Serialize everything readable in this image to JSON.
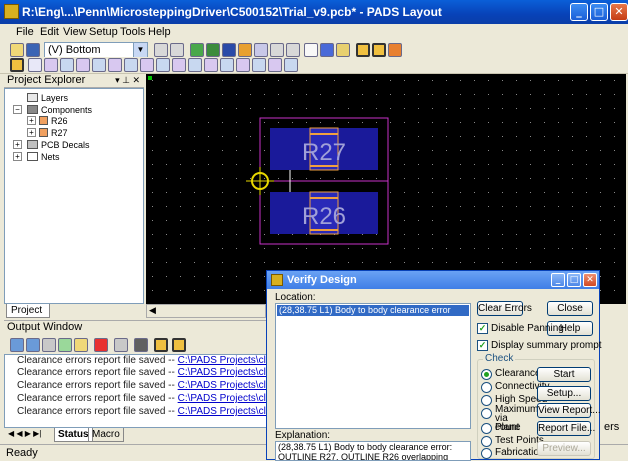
{
  "window": {
    "title": "R:\\Eng\\...\\Penn\\MicrosteppingDriver\\C500152\\Trial_v9.pcb* - PADS Layout",
    "min": "_",
    "max": "□",
    "close": "✕"
  },
  "menu": [
    "File",
    "Edit",
    "View",
    "Setup",
    "Tools",
    "Help"
  ],
  "toolbar": {
    "layer_select": "(V) Bottom"
  },
  "project_explorer": {
    "title": "Project Explorer",
    "items": [
      {
        "label": "Layers",
        "indent": 0,
        "expander": ""
      },
      {
        "label": "Components",
        "indent": 0,
        "expander": "−"
      },
      {
        "label": "R26",
        "indent": 1,
        "expander": "+"
      },
      {
        "label": "R27",
        "indent": 1,
        "expander": "+"
      },
      {
        "label": "PCB Decals",
        "indent": 0,
        "expander": "+"
      },
      {
        "label": "Nets",
        "indent": 0,
        "expander": "+"
      }
    ],
    "tab": "Project"
  },
  "canvas": {
    "colors": {
      "background": "#000000",
      "outline": "#c832c8",
      "pad": "#1a1a9a",
      "pad_edge": "#f0a040",
      "cursor": "#e8d800",
      "ref_text": "#a0a0d8"
    },
    "parts": [
      {
        "ref": "R27"
      },
      {
        "ref": "R26"
      }
    ]
  },
  "output_window": {
    "title": "Output Window",
    "lines": [
      {
        "text": "Clearance errors report file saved -- ",
        "link": "C:\\PADS Projects\\clear.lst"
      },
      {
        "text": "Clearance errors report file saved -- ",
        "link": "C:\\PADS Projects\\clear.lst"
      },
      {
        "text": "Clearance errors report file saved -- ",
        "link": "C:\\PADS Projects\\clear.lst"
      },
      {
        "text": "Clearance errors report file saved -- ",
        "link": "C:\\PADS Projects\\clear.lst"
      },
      {
        "text": "Clearance errors report file saved -- ",
        "link": "C:\\PADS Projects\\clear.lst"
      }
    ],
    "tabs": [
      "Status",
      "Macro"
    ]
  },
  "status": {
    "text": "Ready",
    "right": "ers"
  },
  "verify_dialog": {
    "title": "Verify Design",
    "location_label": "Location:",
    "selected_item": "(28,38.75 L1) Body to body clearance error",
    "explanation_label": "Explanation:",
    "explanation_lines": [
      "(28,38.75 L1) Body to body clearance error:",
      "OUTLINE R27, OUTLINE R26 overlapping"
    ],
    "buttons": {
      "clear_errors": "Clear Errors",
      "close": "Close",
      "help": "Help",
      "start": "Start",
      "setup": "Setup...",
      "view_report": "View Report...",
      "report_file": "Report File...",
      "preview": "Preview..."
    },
    "disable_panning": {
      "label": "Disable Panning",
      "checked": true
    },
    "display_summary": {
      "label": "Display summary prompt",
      "checked": true
    },
    "check_group": "Check",
    "checks": [
      {
        "label": "Clearance",
        "selected": true
      },
      {
        "label": "Connectivity",
        "selected": false
      },
      {
        "label": "High Speed",
        "selected": false
      },
      {
        "label": "Maximum via count",
        "selected": false
      },
      {
        "label": "Plane",
        "selected": false
      },
      {
        "label": "Test Points",
        "selected": false
      },
      {
        "label": "Fabrication",
        "selected": false
      }
    ]
  }
}
